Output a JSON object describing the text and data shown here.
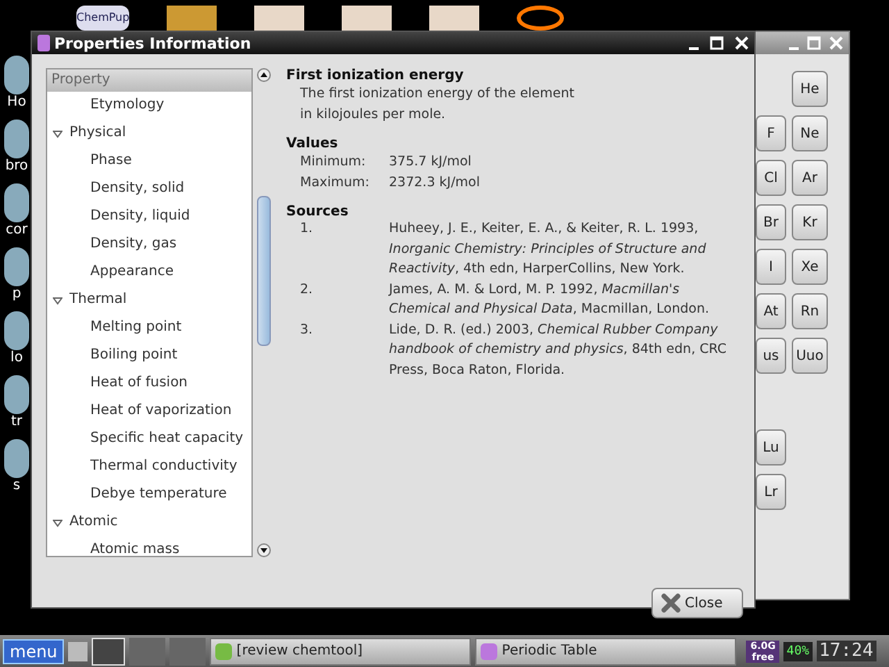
{
  "desktop": {
    "icons": [
      {
        "label": "Ho"
      },
      {
        "label": "bro"
      },
      {
        "label": "cor"
      },
      {
        "label": "p"
      },
      {
        "label": "lo"
      },
      {
        "label": "tr"
      },
      {
        "label": "s"
      }
    ],
    "top_icons": [
      {
        "label": "ChemPup"
      }
    ]
  },
  "background_window": {
    "element_rows": [
      {
        "column_2": "He"
      },
      {
        "column_1": "F",
        "column_2": "Ne"
      },
      {
        "column_1": "Cl",
        "column_2": "Ar"
      },
      {
        "column_1": "Br",
        "column_2": "Kr"
      },
      {
        "column_1": "I",
        "column_2": "Xe"
      },
      {
        "column_1": "At",
        "column_2": "Rn"
      },
      {
        "column_1": "us",
        "column_2": "Uuo"
      }
    ],
    "lower_elements": [
      "Lu",
      "Lr"
    ]
  },
  "window": {
    "title": "Properties Information"
  },
  "tree": {
    "header": "Property",
    "items": [
      {
        "kind": "leaf",
        "label": "Etymology"
      },
      {
        "kind": "group",
        "label": "Physical",
        "expanded": true,
        "children": [
          {
            "label": "Phase"
          },
          {
            "label": "Density, solid"
          },
          {
            "label": "Density, liquid"
          },
          {
            "label": "Density, gas"
          },
          {
            "label": "Appearance"
          }
        ]
      },
      {
        "kind": "group",
        "label": "Thermal",
        "expanded": true,
        "children": [
          {
            "label": "Melting point"
          },
          {
            "label": "Boiling point"
          },
          {
            "label": "Heat of fusion"
          },
          {
            "label": "Heat of vaporization"
          },
          {
            "label": "Specific heat capacity"
          },
          {
            "label": "Thermal conductivity"
          },
          {
            "label": "Debye temperature"
          }
        ]
      },
      {
        "kind": "group",
        "label": "Atomic",
        "expanded": true,
        "children": [
          {
            "label": "Atomic mass"
          }
        ]
      }
    ]
  },
  "details": {
    "title": "First ionization energy",
    "description": "The first ionization energy of the element\nin kilojoules per mole.",
    "values_heading": "Values",
    "values": [
      {
        "label": "Minimum:",
        "value": "375.7 kJ/mol"
      },
      {
        "label": "Maximum:",
        "value": "2372.3 kJ/mol"
      }
    ],
    "sources_heading": "Sources",
    "sources": [
      {
        "number": "1.",
        "text": "Huheey, J. E., Keiter, E. A., & Keiter, R. L. 1993, *Inorganic Chemistry: Principles of Structure and Reactivity*, 4th edn, HarperCollins, New York."
      },
      {
        "number": "2.",
        "text": "James, A. M. & Lord, M. P. 1992, *Macmillan's Chemical and Physical Data*, Macmillan, London."
      },
      {
        "number": "3.",
        "text": "Lide, D. R. (ed.) 2003, *Chemical Rubber Company handbook of chemistry and physics*, 84th edn, CRC Press, Boca Raton, Florida."
      }
    ]
  },
  "close_button": {
    "label": "Close"
  },
  "taskbar": {
    "menu": "menu",
    "tasks": [
      {
        "label": "[review chemtool]",
        "selected": false
      },
      {
        "label": "Periodic Table",
        "selected": false
      }
    ],
    "disk": "6.0G free",
    "battery": "40%",
    "clock": "17:24"
  }
}
